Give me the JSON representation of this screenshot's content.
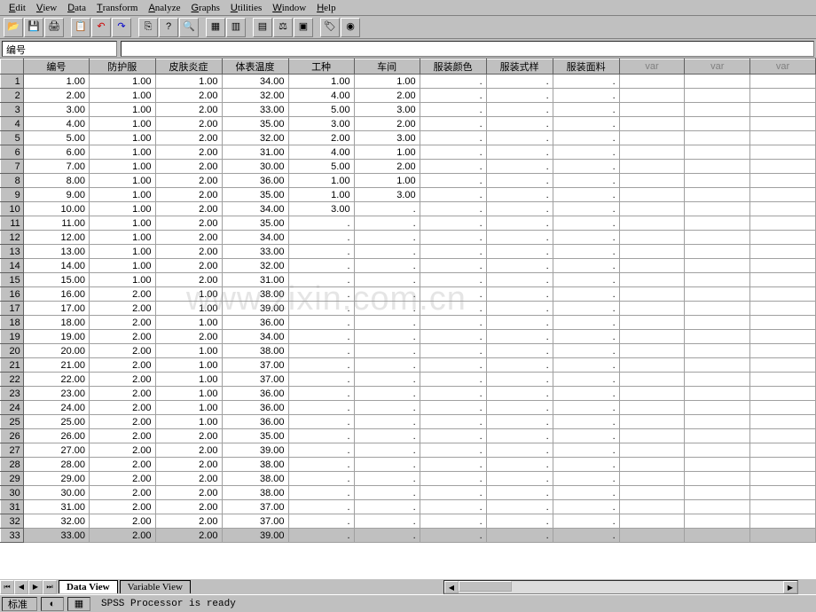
{
  "menu": [
    "Edit",
    "View",
    "Data",
    "Transform",
    "Analyze",
    "Graphs",
    "Utilities",
    "Window",
    "Help"
  ],
  "address_label": "编号",
  "columns": [
    "编号",
    "防护服",
    "皮肤炎症",
    "体表温度",
    "工种",
    "车间",
    "服装颜色",
    "服装式样",
    "服装面料",
    "var",
    "var",
    "var"
  ],
  "rows": [
    {
      "n": 1,
      "c": [
        "1.00",
        "1.00",
        "1.00",
        "34.00",
        "1.00",
        "1.00",
        ".",
        ".",
        "."
      ]
    },
    {
      "n": 2,
      "c": [
        "2.00",
        "1.00",
        "2.00",
        "32.00",
        "4.00",
        "2.00",
        ".",
        ".",
        "."
      ]
    },
    {
      "n": 3,
      "c": [
        "3.00",
        "1.00",
        "2.00",
        "33.00",
        "5.00",
        "3.00",
        ".",
        ".",
        "."
      ]
    },
    {
      "n": 4,
      "c": [
        "4.00",
        "1.00",
        "2.00",
        "35.00",
        "3.00",
        "2.00",
        ".",
        ".",
        "."
      ]
    },
    {
      "n": 5,
      "c": [
        "5.00",
        "1.00",
        "2.00",
        "32.00",
        "2.00",
        "3.00",
        ".",
        ".",
        "."
      ]
    },
    {
      "n": 6,
      "c": [
        "6.00",
        "1.00",
        "2.00",
        "31.00",
        "4.00",
        "1.00",
        ".",
        ".",
        "."
      ]
    },
    {
      "n": 7,
      "c": [
        "7.00",
        "1.00",
        "2.00",
        "30.00",
        "5.00",
        "2.00",
        ".",
        ".",
        "."
      ]
    },
    {
      "n": 8,
      "c": [
        "8.00",
        "1.00",
        "2.00",
        "36.00",
        "1.00",
        "1.00",
        ".",
        ".",
        "."
      ]
    },
    {
      "n": 9,
      "c": [
        "9.00",
        "1.00",
        "2.00",
        "35.00",
        "1.00",
        "3.00",
        ".",
        ".",
        "."
      ]
    },
    {
      "n": 10,
      "c": [
        "10.00",
        "1.00",
        "2.00",
        "34.00",
        "3.00",
        ".",
        ".",
        ".",
        "."
      ]
    },
    {
      "n": 11,
      "c": [
        "11.00",
        "1.00",
        "2.00",
        "35.00",
        ".",
        ".",
        ".",
        ".",
        "."
      ]
    },
    {
      "n": 12,
      "c": [
        "12.00",
        "1.00",
        "2.00",
        "34.00",
        ".",
        ".",
        ".",
        ".",
        "."
      ]
    },
    {
      "n": 13,
      "c": [
        "13.00",
        "1.00",
        "2.00",
        "33.00",
        ".",
        ".",
        ".",
        ".",
        "."
      ]
    },
    {
      "n": 14,
      "c": [
        "14.00",
        "1.00",
        "2.00",
        "32.00",
        ".",
        ".",
        ".",
        ".",
        "."
      ]
    },
    {
      "n": 15,
      "c": [
        "15.00",
        "1.00",
        "2.00",
        "31.00",
        ".",
        ".",
        ".",
        ".",
        "."
      ]
    },
    {
      "n": 16,
      "c": [
        "16.00",
        "2.00",
        "1.00",
        "38.00",
        ".",
        ".",
        ".",
        ".",
        "."
      ]
    },
    {
      "n": 17,
      "c": [
        "17.00",
        "2.00",
        "1.00",
        "39.00",
        ".",
        ".",
        ".",
        ".",
        "."
      ]
    },
    {
      "n": 18,
      "c": [
        "18.00",
        "2.00",
        "1.00",
        "36.00",
        ".",
        ".",
        ".",
        ".",
        "."
      ]
    },
    {
      "n": 19,
      "c": [
        "19.00",
        "2.00",
        "2.00",
        "34.00",
        ".",
        ".",
        ".",
        ".",
        "."
      ]
    },
    {
      "n": 20,
      "c": [
        "20.00",
        "2.00",
        "1.00",
        "38.00",
        ".",
        ".",
        ".",
        ".",
        "."
      ]
    },
    {
      "n": 21,
      "c": [
        "21.00",
        "2.00",
        "1.00",
        "37.00",
        ".",
        ".",
        ".",
        ".",
        "."
      ]
    },
    {
      "n": 22,
      "c": [
        "22.00",
        "2.00",
        "1.00",
        "37.00",
        ".",
        ".",
        ".",
        ".",
        "."
      ]
    },
    {
      "n": 23,
      "c": [
        "23.00",
        "2.00",
        "1.00",
        "36.00",
        ".",
        ".",
        ".",
        ".",
        "."
      ]
    },
    {
      "n": 24,
      "c": [
        "24.00",
        "2.00",
        "1.00",
        "36.00",
        ".",
        ".",
        ".",
        ".",
        "."
      ]
    },
    {
      "n": 25,
      "c": [
        "25.00",
        "2.00",
        "1.00",
        "36.00",
        ".",
        ".",
        ".",
        ".",
        "."
      ]
    },
    {
      "n": 26,
      "c": [
        "26.00",
        "2.00",
        "2.00",
        "35.00",
        ".",
        ".",
        ".",
        ".",
        "."
      ]
    },
    {
      "n": 27,
      "c": [
        "27.00",
        "2.00",
        "2.00",
        "39.00",
        ".",
        ".",
        ".",
        ".",
        "."
      ]
    },
    {
      "n": 28,
      "c": [
        "28.00",
        "2.00",
        "2.00",
        "38.00",
        ".",
        ".",
        ".",
        ".",
        "."
      ]
    },
    {
      "n": 29,
      "c": [
        "29.00",
        "2.00",
        "2.00",
        "38.00",
        ".",
        ".",
        ".",
        ".",
        "."
      ]
    },
    {
      "n": 30,
      "c": [
        "30.00",
        "2.00",
        "2.00",
        "38.00",
        ".",
        ".",
        ".",
        ".",
        "."
      ]
    },
    {
      "n": 31,
      "c": [
        "31.00",
        "2.00",
        "2.00",
        "37.00",
        ".",
        ".",
        ".",
        ".",
        "."
      ]
    },
    {
      "n": 32,
      "c": [
        "32.00",
        "2.00",
        "2.00",
        "37.00",
        ".",
        ".",
        ".",
        ".",
        "."
      ]
    },
    {
      "n": 33,
      "c": [
        "33.00",
        "2.00",
        "2.00",
        "39.00",
        ".",
        ".",
        ".",
        ".",
        "."
      ]
    }
  ],
  "tabs": {
    "active": "Data View",
    "inactive": "Variable View"
  },
  "status": {
    "left": "标准",
    "msg": "SPSS Processor  is ready"
  },
  "watermark": "www.zixin.com.cn",
  "toolbar_icons": [
    "open",
    "save",
    "print",
    "|",
    "history",
    "undo",
    "redo",
    "|",
    "goto",
    "help",
    "find",
    "|",
    "table",
    "insert",
    "|",
    "vars",
    "weight",
    "select",
    "|",
    "value",
    "labels"
  ]
}
